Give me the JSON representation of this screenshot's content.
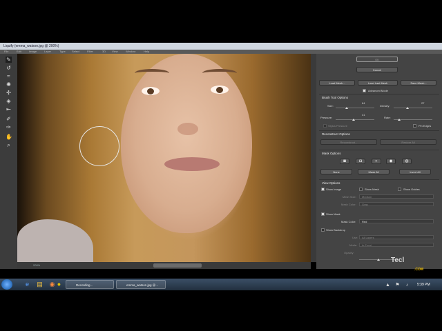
{
  "window": {
    "title": "Liquify (emma_watson.jpg @ 200%)"
  },
  "menu": [
    "File",
    "Edit",
    "Image",
    "Layer",
    "Type",
    "Select",
    "Filter",
    "3D",
    "View",
    "Window",
    "Help"
  ],
  "tools": [
    "forward-warp",
    "reconstruct",
    "smooth",
    "twirl",
    "pucker",
    "bloat",
    "push-left",
    "freeze-mask",
    "thaw-mask",
    "face",
    "hand",
    "zoom"
  ],
  "canvas": {
    "zoom_label": "200%"
  },
  "panel": {
    "ok": "OK",
    "cancel": "Cancel",
    "load_mesh": "Load Mesh...",
    "load_last_mesh": "Load Last Mesh",
    "save_mesh": "Save Mesh...",
    "advanced_mode": "Advanced Mode",
    "brush_tool_options": "Brush Tool Options",
    "size_label": "Size:",
    "size_value": "64",
    "density_label": "Density:",
    "density_value": "27",
    "pressure_label": "Pressure:",
    "pressure_value": "41",
    "rate_label": "Rate:",
    "stylus_pressure": "Stylus Pressure",
    "pin_edges": "Pin Edges",
    "reconstruct_options": "Reconstruct Options",
    "reconstruct_btn": "Reconstruct...",
    "restore_all": "Restore All",
    "mask_options": "Mask Options",
    "none": "None",
    "mask_all": "Mask All",
    "invert_all": "Invert All",
    "view_options": "View Options",
    "show_image": "Show Image",
    "show_mesh": "Show Mesh",
    "show_guides": "Show Guides",
    "mesh_size_label": "Mesh Size:",
    "mesh_size_value": "Medium",
    "mesh_color_label": "Mesh Color:",
    "mesh_color_value": "Gray",
    "show_mask": "Show Mask",
    "mask_color_label": "Mask Color:",
    "mask_color_value": "Red",
    "show_backdrop": "Show Backdrop",
    "use_label": "Use:",
    "use_value": "All Layers",
    "mode_label": "Mode:",
    "mode_value": "In Front",
    "opacity_label": "Opacity:"
  },
  "taskbar": {
    "tasks": [
      "Recording...",
      "emma_watson.jpg @..."
    ],
    "time": "5:39 PM"
  },
  "watermark": {
    "text": "Tecl",
    "sub": ".COM"
  }
}
